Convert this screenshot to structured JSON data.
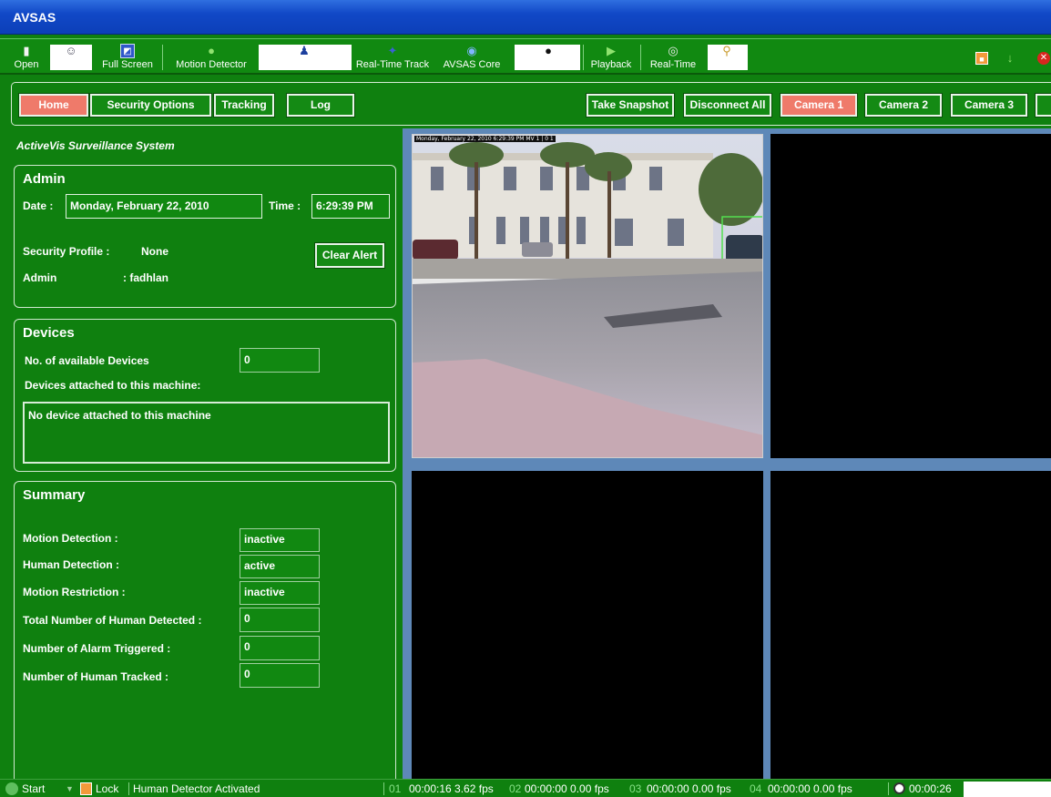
{
  "window": {
    "title": "AVSAS"
  },
  "toolbar": {
    "items": [
      {
        "label": "Open",
        "icon": "door-icon"
      },
      {
        "label": "",
        "icon": "people-icon"
      },
      {
        "label": "Full Screen",
        "icon": "fullscreen-icon"
      },
      {
        "label": "Motion Detector",
        "icon": "motion-icon"
      },
      {
        "label": "",
        "icon": "user-icon"
      },
      {
        "label": "Real-Time Track",
        "icon": "track-icon"
      },
      {
        "label": "AVSAS Core",
        "icon": "globe-icon"
      },
      {
        "label": "",
        "icon": "webcam-icon"
      },
      {
        "label": "Playback",
        "icon": "play-icon"
      },
      {
        "label": "Real-Time",
        "icon": "realtime-icon"
      },
      {
        "label": "",
        "icon": "magnifier-icon"
      }
    ]
  },
  "nav": {
    "home": "Home",
    "security": "Security Options",
    "tracking": "Tracking",
    "log": "Log",
    "snapshot": "Take Snapshot",
    "disconnect": "Disconnect All",
    "camera1": "Camera 1",
    "camera2": "Camera 2",
    "camera3": "Camera 3"
  },
  "brand": "ActiveVis Surveillance System",
  "admin": {
    "title": "Admin",
    "date_label": "Date :",
    "date_value": "Monday, February 22, 2010",
    "time_label": "Time :",
    "time_value": "6:29:39 PM",
    "profile_label": "Security Profile :",
    "profile_value": "None",
    "admin_label": "Admin",
    "admin_value": ":  fadhlan",
    "clear_alert": "Clear Alert"
  },
  "devices": {
    "title": "Devices",
    "available_label": "No. of available Devices",
    "available_value": "0",
    "attached_label": "Devices attached to this machine:",
    "attached_value": "No device attached to this machine"
  },
  "summary": {
    "title": "Summary",
    "rows": [
      {
        "label": "Motion Detection :",
        "value": "inactive"
      },
      {
        "label": "Human Detection :",
        "value": "active"
      },
      {
        "label": "Motion Restriction :",
        "value": "inactive"
      },
      {
        "label": "Total Number of Human Detected :",
        "value": "0"
      },
      {
        "label": "Number of Alarm Triggered :",
        "value": "0"
      },
      {
        "label": "Number of Human Tracked :",
        "value": "0"
      }
    ]
  },
  "camera_overlay": "Monday, February 22, 2010 6:29:39 PM        MV 1 | 0 1",
  "status": {
    "start": "Start",
    "lock": "Lock",
    "message": "Human Detector Activated",
    "ch1_num": "01",
    "ch1": "00:00:16  3.62 fps",
    "ch2_num": "02",
    "ch2": "00:00:00  0.00 fps",
    "ch3_num": "03",
    "ch3": "00:00:00  0.00 fps",
    "ch4_num": "04",
    "ch4": "00:00:00  0.00 fps",
    "clock": "00:00:26"
  },
  "colors": {
    "green_bg": "#0f800f",
    "active_tab": "#ef7a6a",
    "title_blue": "#1148c7",
    "video_frame": "#5e88b8"
  }
}
